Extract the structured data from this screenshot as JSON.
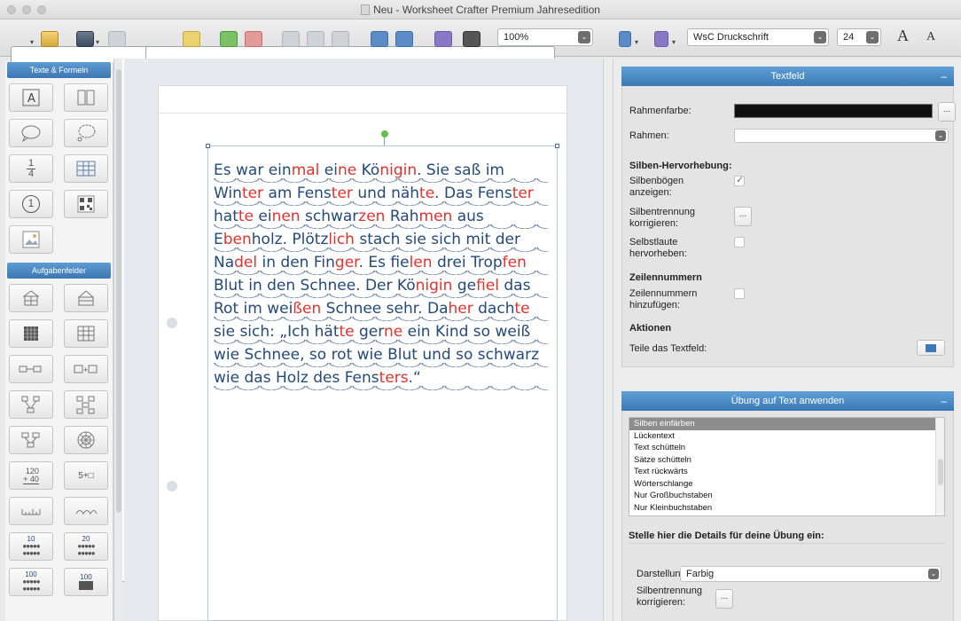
{
  "window": {
    "title": "Neu  - Worksheet Crafter Premium Jahresedition"
  },
  "toolbar": {
    "zoom": "100%",
    "font": "WsC Druckschrift",
    "font_size": "24",
    "grow_font_label": "A",
    "shrink_font_label": "A"
  },
  "palette": {
    "section_text": "Texte & Formeln",
    "section_tasks": "Aufgabenfelder",
    "fraction_num": "1",
    "fraction_den": "4",
    "circle_num": "1",
    "calc_top": "120",
    "calc_bottom": "+ 40",
    "equation": "5+□",
    "dots_a": "10",
    "dots_b": "20",
    "dots_c": "100",
    "dots_d": "100"
  },
  "story": {
    "lines": [
      [
        [
          "Es war ein",
          false
        ],
        [
          "mal",
          true
        ],
        [
          " ei",
          false
        ],
        [
          "ne",
          true
        ],
        [
          " Kö",
          false
        ],
        [
          "nigin",
          true
        ],
        [
          ". Sie saß im",
          false
        ]
      ],
      [
        [
          "Win",
          false
        ],
        [
          "ter",
          true
        ],
        [
          " am Fens",
          false
        ],
        [
          "ter",
          true
        ],
        [
          " und näh",
          false
        ],
        [
          "te",
          true
        ],
        [
          ". Das Fens",
          false
        ],
        [
          "ter",
          true
        ]
      ],
      [
        [
          "hat",
          false
        ],
        [
          "te",
          true
        ],
        [
          " ei",
          false
        ],
        [
          "nen",
          true
        ],
        [
          " schwar",
          false
        ],
        [
          "zen",
          true
        ],
        [
          " Rah",
          false
        ],
        [
          "men",
          true
        ],
        [
          " aus",
          false
        ]
      ],
      [
        [
          "E",
          false
        ],
        [
          "ben",
          true
        ],
        [
          "holz. Plötz",
          false
        ],
        [
          "lich",
          true
        ],
        [
          " stach sie sich mit der",
          false
        ]
      ],
      [
        [
          "Na",
          false
        ],
        [
          "del",
          true
        ],
        [
          " in den Fin",
          false
        ],
        [
          "ger",
          true
        ],
        [
          ". Es fie",
          false
        ],
        [
          "len",
          true
        ],
        [
          " drei Trop",
          false
        ],
        [
          "fen",
          true
        ]
      ],
      [
        [
          "Blut in den Schnee. Der Kö",
          false
        ],
        [
          "nigin",
          true
        ],
        [
          " ge",
          false
        ],
        [
          "fiel",
          true
        ],
        [
          " das",
          false
        ]
      ],
      [
        [
          "Rot im wei",
          false
        ],
        [
          "ßen",
          true
        ],
        [
          " Schnee sehr. Da",
          false
        ],
        [
          "her",
          true
        ],
        [
          " dach",
          false
        ],
        [
          "te",
          true
        ]
      ],
      [
        [
          "sie sich: „Ich hät",
          false
        ],
        [
          "te",
          true
        ],
        [
          " ger",
          false
        ],
        [
          "ne",
          true
        ],
        [
          " ein Kind so weiß",
          false
        ]
      ],
      [
        [
          "wie Schnee, so rot wie Blut und so schwarz",
          false
        ]
      ],
      [
        [
          "wie das Holz des Fens",
          false
        ],
        [
          "ters",
          true
        ],
        [
          ".“",
          false
        ]
      ]
    ]
  },
  "inspector": {
    "textfeld": {
      "header": "Textfeld",
      "frame_color_label": "Rahmenfarbe:",
      "frame_color": "#111111",
      "frame_label": "Rahmen:",
      "syllable_heading": "Silben-Hervorhebung:",
      "syllable_arcs_label": "Silbenbögen anzeigen:",
      "syllable_arcs_checked": true,
      "syllable_fix_label": "Silbentrennung korrigieren:",
      "vowels_label": "Selbstlaute hervorheben:",
      "vowels_checked": false,
      "line_numbers_heading": "Zeilennummern",
      "line_numbers_label": "Zeilennummern hinzufügen:",
      "line_numbers_checked": false,
      "actions_heading": "Aktionen",
      "split_label": "Teile das Textfeld:",
      "dots": "..."
    },
    "exercise": {
      "header": "Übung auf Text anwenden",
      "items": [
        "Silben einfärben",
        "Lückentext",
        "Text schütteln",
        "Sätze schütteln",
        "Text rückwärts",
        "Wörterschlange",
        "Nur Großbuchstaben",
        "Nur Kleinbuchstaben"
      ],
      "selected": "Silben einfärben",
      "details_heading": "Stelle hier die Details für deine Übung ein:",
      "display_label": "Darstellung:",
      "display_value": "Farbig",
      "syllable_fix_label": "Silbentrennung korrigieren:",
      "dots": "..."
    }
  },
  "colors": {
    "accent": "#3d77b4",
    "text_blue": "#234a7a",
    "syllable_red": "#e2322d"
  }
}
